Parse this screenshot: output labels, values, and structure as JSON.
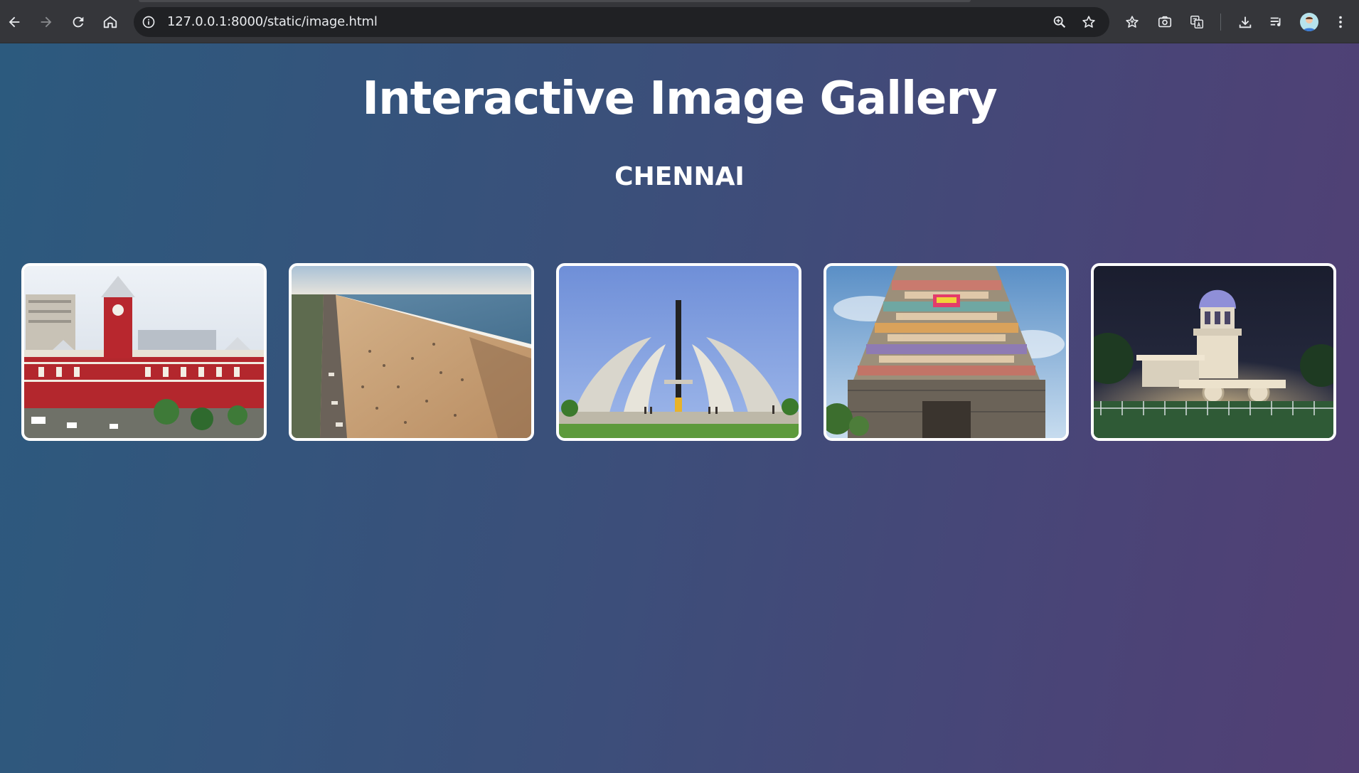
{
  "browser": {
    "url": "127.0.0.1:8000/static/image.html",
    "icons": {
      "back": "arrow-left-icon",
      "forward": "arrow-right-icon",
      "reload": "reload-icon",
      "home": "home-icon",
      "info": "info-icon",
      "zoom": "zoom-icon",
      "bookmark": "star-icon",
      "extensions": "bookmark-star-icon",
      "screenshot": "camera-icon",
      "translate": "translate-icon",
      "download": "download-icon",
      "media": "media-queue-icon",
      "menu": "more-vert-icon"
    }
  },
  "page": {
    "title": "Interactive Image Gallery",
    "subtitle": "CHENNAI",
    "gallery": [
      {
        "subject": "chennai-central-station-photo"
      },
      {
        "subject": "marina-beach-photo"
      },
      {
        "subject": "mgr-memorial-photo"
      },
      {
        "subject": "kapaleeshwarar-temple-gopuram-photo"
      },
      {
        "subject": "valluvar-kottam-chariot-photo"
      }
    ]
  },
  "colors": {
    "card_border": "#ffffff",
    "title_text": "#ffffff",
    "gradient_start": "#2c5a7e",
    "gradient_end": "#523f74",
    "chrome_bg": "#35363a",
    "omnibox_bg": "#202124"
  }
}
